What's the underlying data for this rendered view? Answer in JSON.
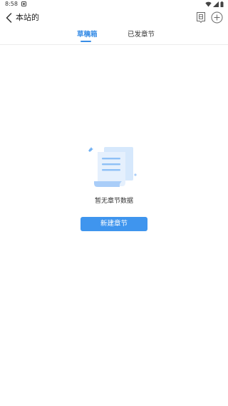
{
  "status_bar": {
    "time": "8:58"
  },
  "header": {
    "title": "本站的"
  },
  "tabs": [
    {
      "label": "草稿箱",
      "active": true
    },
    {
      "label": "已发章节",
      "active": false
    }
  ],
  "empty_state": {
    "message": "暂无章节数据"
  },
  "actions": {
    "new_chapter_label": "新建章节"
  },
  "colors": {
    "accent": "#3a8ee6",
    "button": "#3f95ee",
    "illustration": "#a9cdf8"
  },
  "icons": [
    "notification-icon",
    "wifi-icon",
    "signal-icon",
    "battery-icon",
    "back-arrow-icon",
    "book-icon",
    "add-circle-icon",
    "empty-document-icon"
  ]
}
